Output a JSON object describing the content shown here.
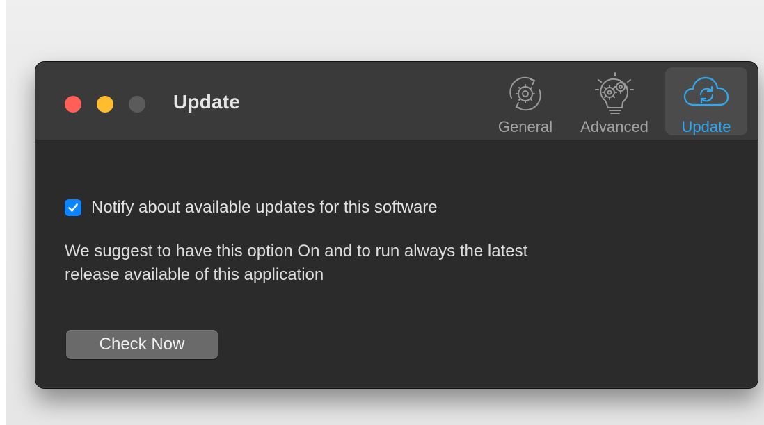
{
  "window": {
    "title": "Update"
  },
  "toolbar": {
    "tabs": [
      {
        "label": "General",
        "icon": "gear-cycle-icon",
        "selected": false
      },
      {
        "label": "Advanced",
        "icon": "lightbulb-gears-icon",
        "selected": false
      },
      {
        "label": "Update",
        "icon": "cloud-sync-icon",
        "selected": true
      }
    ]
  },
  "content": {
    "notify_checkbox": {
      "label": "Notify about available updates for this software",
      "checked": true
    },
    "description_line1": "We suggest to have this option On and to run always the latest",
    "description_line2": "release available of this application",
    "check_button_label": "Check Now"
  },
  "colors": {
    "accent": "#0a84ff",
    "selected_tab_text": "#2ea8f0",
    "close": "#ff5f57",
    "minimize": "#febc2e",
    "zoom_inactive": "#5b5b5b",
    "window_background": "#2b2b2b",
    "titlebar_background": "#3a3a3a"
  }
}
